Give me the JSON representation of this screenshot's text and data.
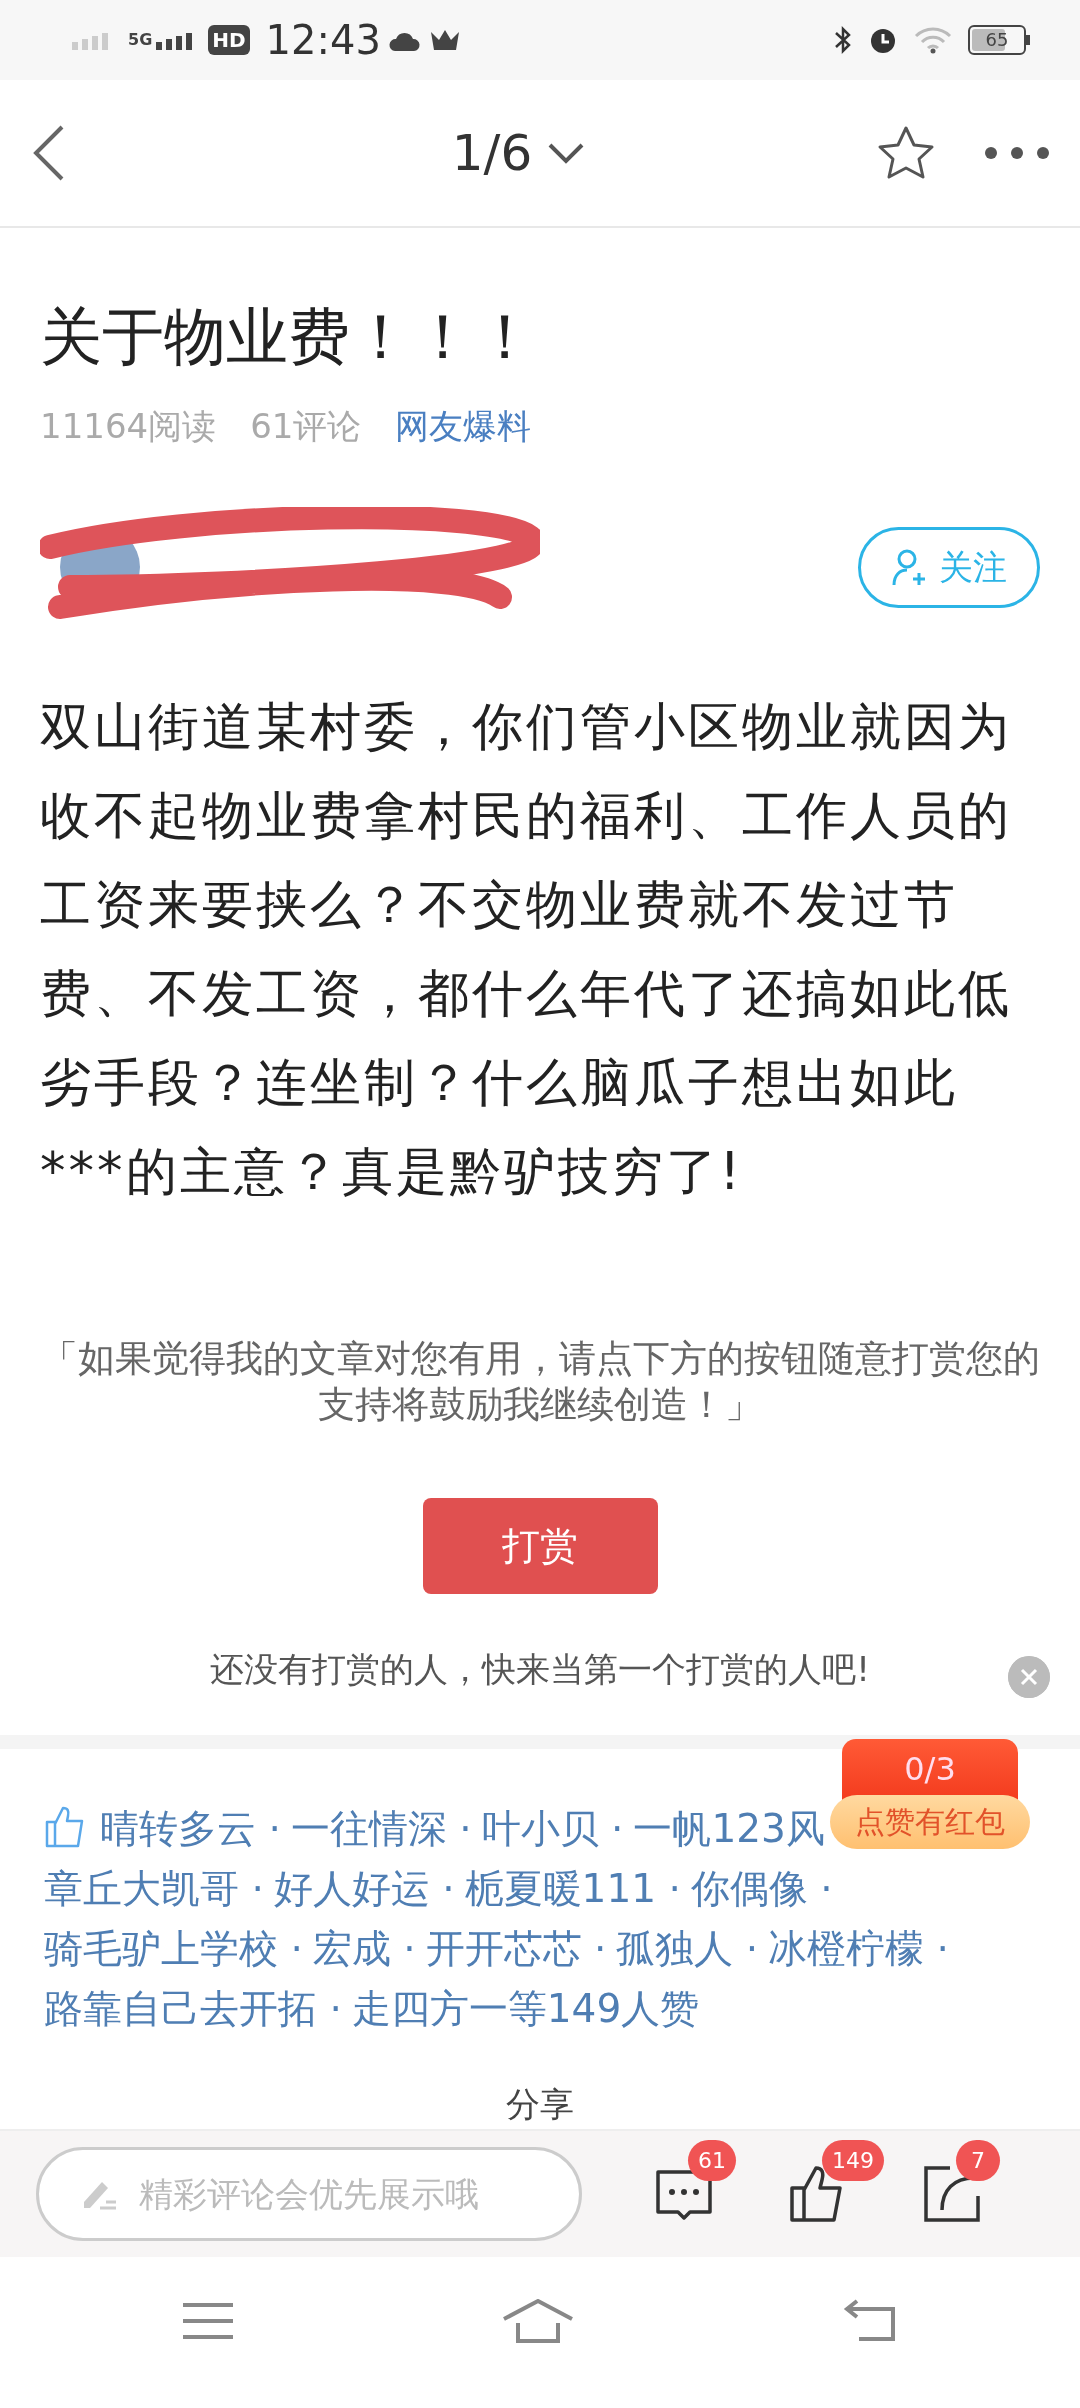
{
  "status_bar": {
    "time": "12:43",
    "network": "5G",
    "hd": "HD",
    "battery": "65"
  },
  "header": {
    "page": "1/6"
  },
  "article": {
    "title": "关于物业费！！！",
    "reads": "11164阅读",
    "comments": "61评论",
    "category": "网友爆料"
  },
  "follow_button": "关注",
  "body": "双山街道某村委，你们管小区物业就因为收不起物业费拿村民的福利、工作人员的工资来要挟么？不交物业费就不发过节费、不发工资，都什么年代了还搞如此低劣手段？连坐制？什么脑瓜子想出如此***的主意？真是黔驴技穷了!",
  "reward": {
    "prompt": "「如果觉得我的文章对您有用，请点下方的按钮随意打赏您的支持将鼓励我继续创造！」",
    "button": "打赏",
    "empty": "还没有打赏的人，快来当第一个打赏的人吧!"
  },
  "likes": {
    "lines": [
      [
        "晴转多云 ·",
        "一往情深 ·",
        "叶小贝 ·",
        "一帆123风"
      ],
      [
        "章丘大凯哥 ·",
        "好人好运 ·",
        "栀夏暖111 ·",
        "你偶像 ·"
      ],
      [
        "骑毛驴上学校 ·",
        "宏成 ·",
        "开开芯芯 ·",
        "孤独人 ·",
        "冰橙柠檬 ·"
      ],
      [
        "路靠自己去开拓 ·",
        "走四方一等"
      ]
    ],
    "summary": "149人赞"
  },
  "red_packet": {
    "count": "0/3",
    "label": "点赞有红包"
  },
  "share_label": "分享",
  "bottom_bar": {
    "placeholder": "精彩评论会优先展示哦",
    "comment_count": "61",
    "like_count": "149",
    "share_count": "7"
  }
}
